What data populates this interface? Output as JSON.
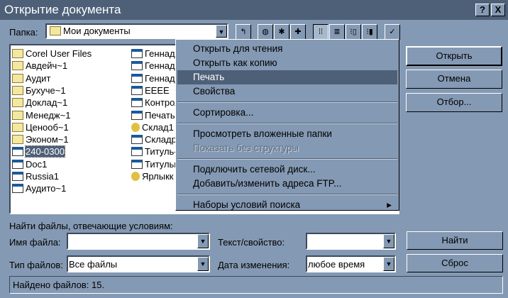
{
  "title": "Открытие документа",
  "title_buttons": {
    "help": "?",
    "close": "X"
  },
  "folder": {
    "label": "Папка:",
    "value": "Мои документы"
  },
  "files_col1": [
    {
      "name": "Corel User Files",
      "type": "folder"
    },
    {
      "name": "Авдейч~1",
      "type": "folder"
    },
    {
      "name": "Аудит",
      "type": "folder"
    },
    {
      "name": "Бухуче~1",
      "type": "folder"
    },
    {
      "name": "Доклад~1",
      "type": "folder"
    },
    {
      "name": "Менедж~1",
      "type": "folder"
    },
    {
      "name": "Ценооб~1",
      "type": "folder"
    },
    {
      "name": "Эконом~1",
      "type": "folder"
    },
    {
      "name": "240-0300",
      "type": "doc",
      "selected": true
    },
    {
      "name": "Doc1",
      "type": "doc"
    },
    {
      "name": "Russia1",
      "type": "app"
    },
    {
      "name": "Аудито~1",
      "type": "doc"
    }
  ],
  "files_col2": [
    {
      "name": "Геннади",
      "type": "doc"
    },
    {
      "name": "Геннади",
      "type": "doc"
    },
    {
      "name": "Геннади",
      "type": "doc"
    },
    {
      "name": "EEEE",
      "type": "doc"
    },
    {
      "name": "Контрол",
      "type": "doc"
    },
    {
      "name": "Печать",
      "type": "doc"
    },
    {
      "name": "Склад1",
      "type": "key"
    },
    {
      "name": "Складр-",
      "type": "doc"
    },
    {
      "name": "Титуль-",
      "type": "doc"
    },
    {
      "name": "Титульн",
      "type": "doc"
    },
    {
      "name": "Ярлыкк",
      "type": "key"
    }
  ],
  "context_menu": [
    {
      "label": "Открыть для чтения"
    },
    {
      "label": "Открыть как копию"
    },
    {
      "label": "Печать",
      "highlighted": true
    },
    {
      "label": "Свойства"
    },
    {
      "sep": true
    },
    {
      "label": "Сортировка..."
    },
    {
      "sep": true
    },
    {
      "label": "Просмотреть вложенные папки"
    },
    {
      "label": "Показать без структуры",
      "disabled": true
    },
    {
      "sep": true
    },
    {
      "label": "Подключить сетевой диск..."
    },
    {
      "label": "Добавить/изменить адреса FTP..."
    },
    {
      "sep": true
    },
    {
      "label": "Наборы условий поиска",
      "submenu": true
    }
  ],
  "buttons": {
    "open": "Открыть",
    "cancel": "Отмена",
    "filter": "Отбор...",
    "find": "Найти",
    "reset": "Сброс"
  },
  "search": {
    "heading": "Найти файлы, отвечающие условиям:",
    "filename_label": "Имя файла:",
    "filename_value": "",
    "text_label": "Текст/свойство:",
    "text_value": "",
    "filetype_label": "Тип файлов:",
    "filetype_value": "Все файлы",
    "date_label": "Дата изменения:",
    "date_value": "любое время"
  },
  "status": "Найдено файлов: 15."
}
